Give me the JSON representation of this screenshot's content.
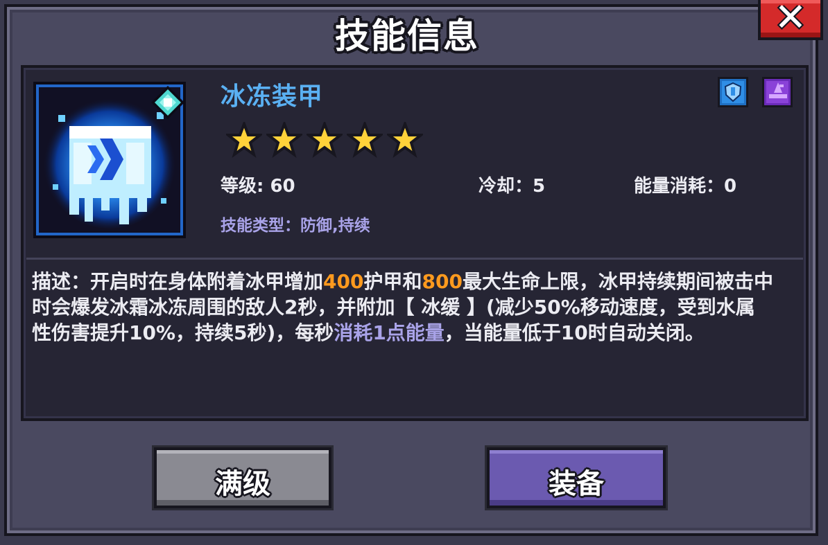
{
  "dialog": {
    "title": "技能信息",
    "close_label": "✕"
  },
  "skill": {
    "name": "冰冻装甲",
    "icon": "ice-armor-icon",
    "rarity_gem": "cyan-gem-icon",
    "stars": 5,
    "level_label": "等级: 60",
    "cooldown_label": "冷却：5",
    "energy_label": "能量消耗：0",
    "type_label": "技能类型：防御,持续",
    "badges": [
      "blue-shield-badge-icon",
      "purple-wizard-hat-badge-icon"
    ]
  },
  "description": {
    "p1": "描述：开启时在身体附着冰甲增加",
    "v1": "400",
    "p2": "护甲和",
    "v2": "800",
    "p3": "最大生命上限，冰甲持续期间被击中时会爆发冰霜冰冻周围的敌人2秒，并附加【 冰缓 】(减少50%移动速度，受到水属性伤害提升10%，持续5秒)，每秒",
    "v3": "消耗1点能量",
    "p4": "，当能量低于10时自动关闭。"
  },
  "buttons": {
    "max_level": "满级",
    "equip": "装备"
  },
  "colors": {
    "name": "#5ab0f2",
    "highlight_orange": "#ff9a1e",
    "highlight_purple": "#a9a3e8",
    "star": "#ffd23a",
    "close": "#d42a2a",
    "equip": "#6b5ab0"
  }
}
